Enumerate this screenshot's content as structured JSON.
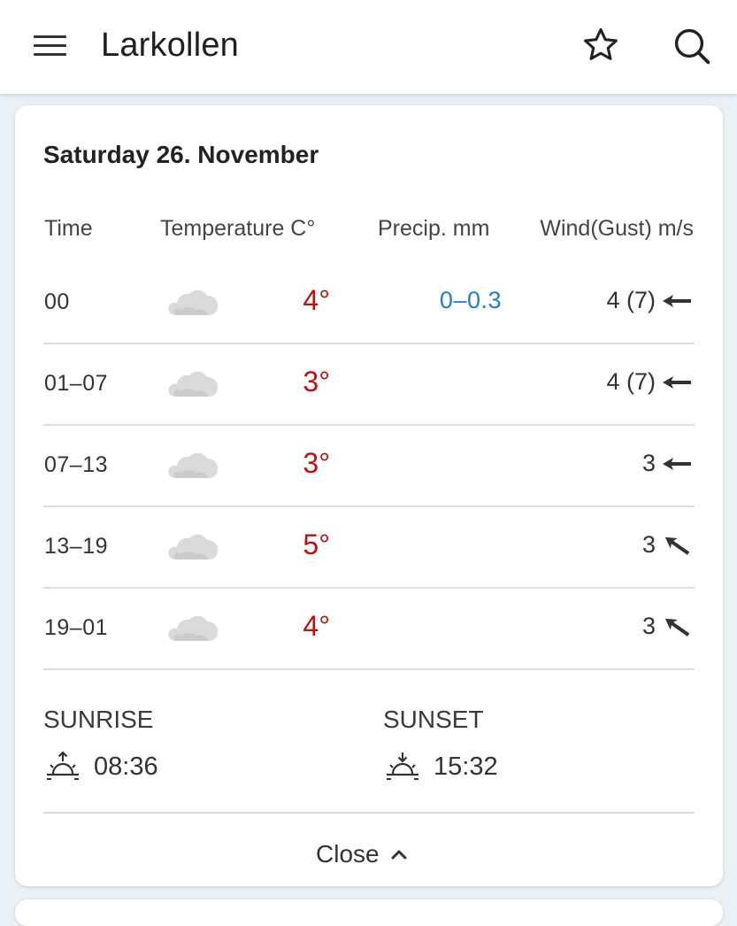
{
  "app_bar": {
    "title": "Larkollen",
    "icons": [
      "menu-icon",
      "star-icon",
      "search-icon"
    ]
  },
  "day": {
    "title": "Saturday 26. November",
    "headers": {
      "time": "Time",
      "temperature": "Temperature C°",
      "precip": "Precip. mm",
      "wind": "Wind(Gust) m/s"
    },
    "rows": [
      {
        "time": "00",
        "icon": "cloud-icon",
        "temp": "4°",
        "precip": "0–0.3",
        "wind": "4 (7)",
        "wind_arrow": "arrow-left"
      },
      {
        "time": "01–07",
        "icon": "cloud-icon",
        "temp": "3°",
        "precip": "",
        "wind": "4 (7)",
        "wind_arrow": "arrow-left"
      },
      {
        "time": "07–13",
        "icon": "cloud-icon",
        "temp": "3°",
        "precip": "",
        "wind": "3",
        "wind_arrow": "arrow-left"
      },
      {
        "time": "13–19",
        "icon": "cloud-icon",
        "temp": "5°",
        "precip": "",
        "wind": "3",
        "wind_arrow": "arrow-up-left"
      },
      {
        "time": "19–01",
        "icon": "cloud-icon",
        "temp": "4°",
        "precip": "",
        "wind": "3",
        "wind_arrow": "arrow-up-left"
      }
    ],
    "sunrise": {
      "label": "SUNRISE",
      "time": "08:36",
      "icon": "sunrise-icon"
    },
    "sunset": {
      "label": "SUNSET",
      "time": "15:32",
      "icon": "sunset-icon"
    },
    "close_label": "Close",
    "close_icon": "chevron-up-icon"
  },
  "colors": {
    "temperature": "#c40d0d",
    "precipitation": "#1e7fcc",
    "background": "#e9f1f4"
  }
}
